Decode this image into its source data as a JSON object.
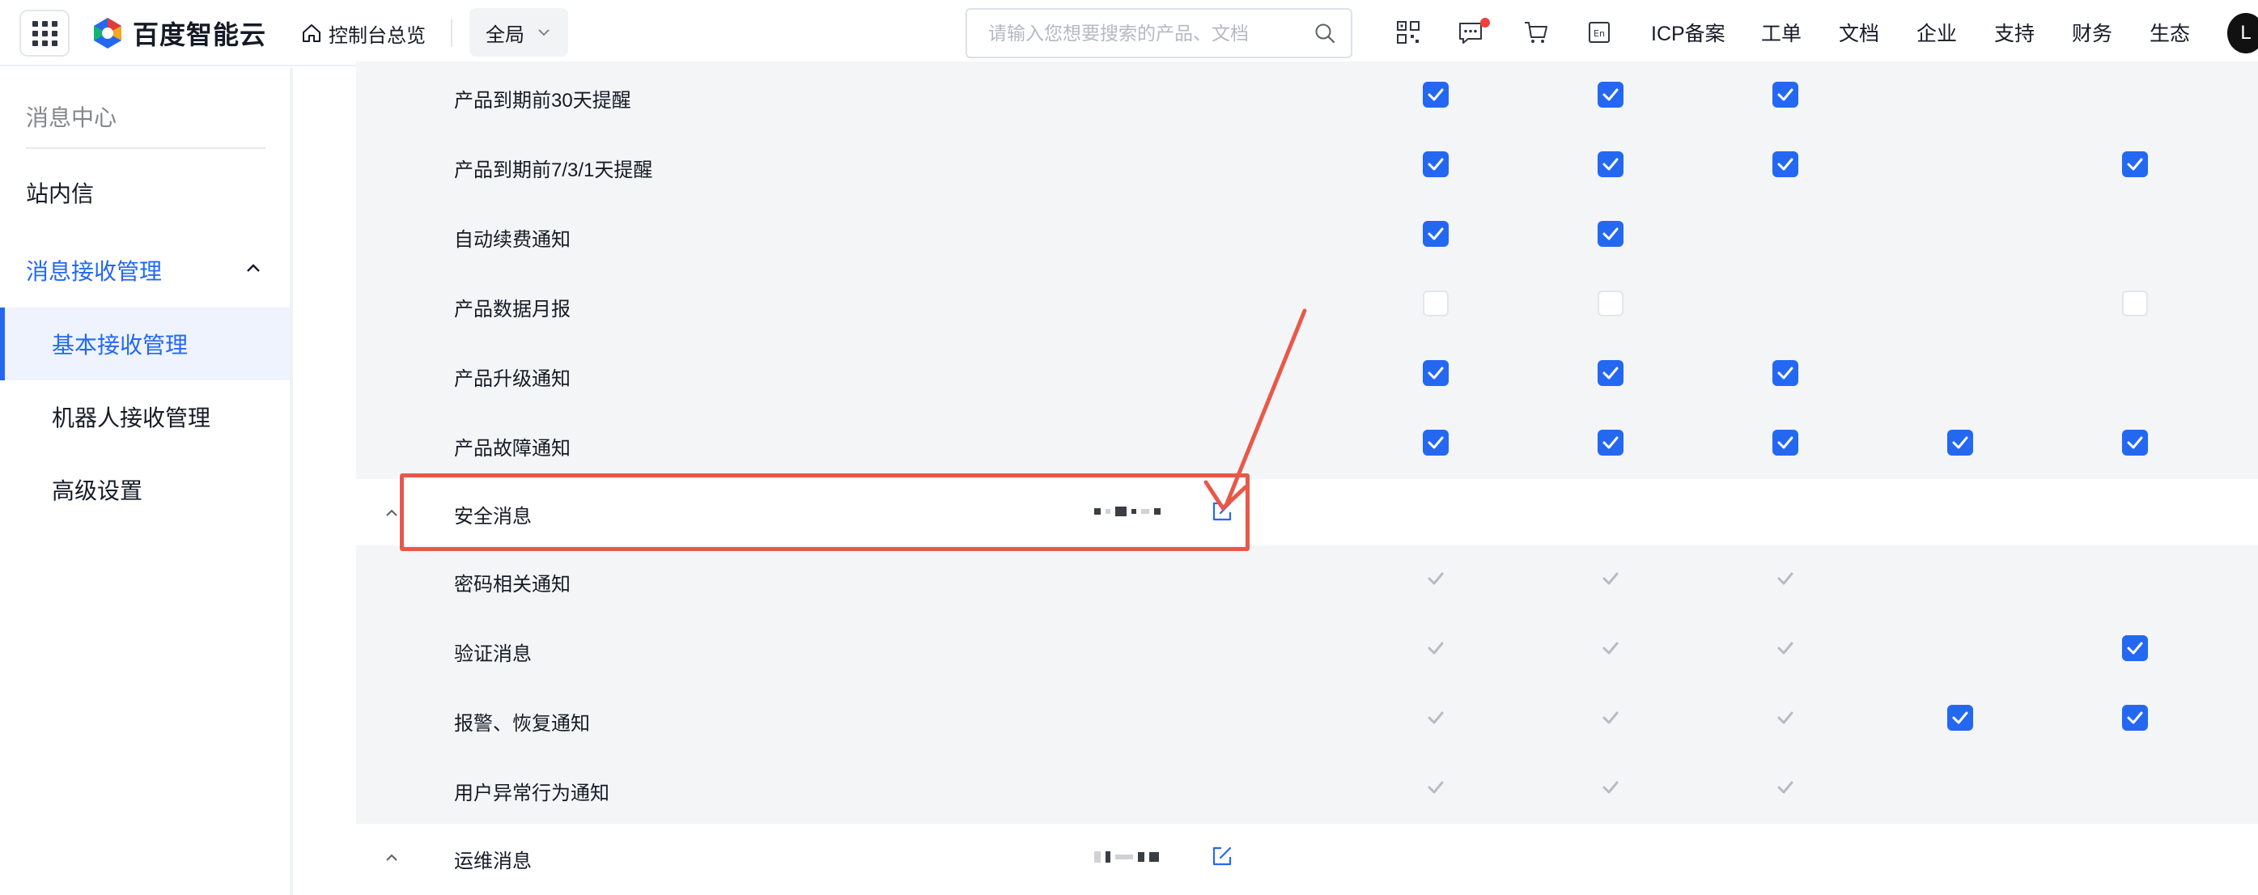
{
  "topbar": {
    "brand": "百度智能云",
    "overview_label": "控制台总览",
    "scope_label": "全局",
    "search_placeholder": "请输入您想要搜索的产品、文档",
    "nav_links": [
      "ICP备案",
      "工单",
      "文档",
      "企业",
      "支持",
      "财务",
      "生态"
    ],
    "avatar_letter": "L",
    "icons": [
      "apps-grid-icon",
      "qrcode-icon",
      "message-icon",
      "cart-icon",
      "language-en-icon",
      "search-icon"
    ],
    "colors": {
      "notification_dot": "#f0403c"
    }
  },
  "sidebar": {
    "title": "消息中心",
    "inbox_label": "站内信",
    "group_label": "消息接收管理",
    "sub_items": [
      "基本接收管理",
      "机器人接收管理",
      "高级设置"
    ],
    "active_item": "基本接收管理"
  },
  "table": {
    "rows": [
      {
        "type": "item",
        "label": "产品到期前30天提醒",
        "checks": [
          "on",
          "on",
          "on",
          "none",
          "none"
        ]
      },
      {
        "type": "item",
        "label": "产品到期前7/3/1天提醒",
        "checks": [
          "on",
          "on",
          "on",
          "none",
          "on"
        ]
      },
      {
        "type": "item",
        "label": "自动续费通知",
        "checks": [
          "on",
          "on",
          "none",
          "none",
          "none"
        ]
      },
      {
        "type": "item",
        "label": "产品数据月报",
        "checks": [
          "off",
          "off",
          "none",
          "none",
          "off"
        ]
      },
      {
        "type": "item",
        "label": "产品升级通知",
        "checks": [
          "on",
          "on",
          "on",
          "none",
          "none"
        ]
      },
      {
        "type": "item",
        "label": "产品故障通知",
        "checks": [
          "on",
          "on",
          "on",
          "on",
          "on"
        ]
      },
      {
        "type": "group",
        "label": "安全消息",
        "expanded": true
      },
      {
        "type": "item",
        "label": "密码相关通知",
        "checks": [
          "disabled",
          "disabled",
          "disabled",
          "none",
          "none"
        ]
      },
      {
        "type": "item",
        "label": "验证消息",
        "checks": [
          "disabled",
          "disabled",
          "disabled",
          "none",
          "on"
        ]
      },
      {
        "type": "item",
        "label": "报警、恢复通知",
        "checks": [
          "disabled",
          "disabled",
          "disabled",
          "on",
          "on"
        ]
      },
      {
        "type": "item",
        "label": "用户异常行为通知",
        "checks": [
          "disabled",
          "disabled",
          "disabled",
          "none",
          "none"
        ]
      },
      {
        "type": "group",
        "label": "运维消息",
        "expanded": true
      }
    ]
  },
  "colors": {
    "accent": "#2468f2",
    "annotation": "#e8584a"
  }
}
